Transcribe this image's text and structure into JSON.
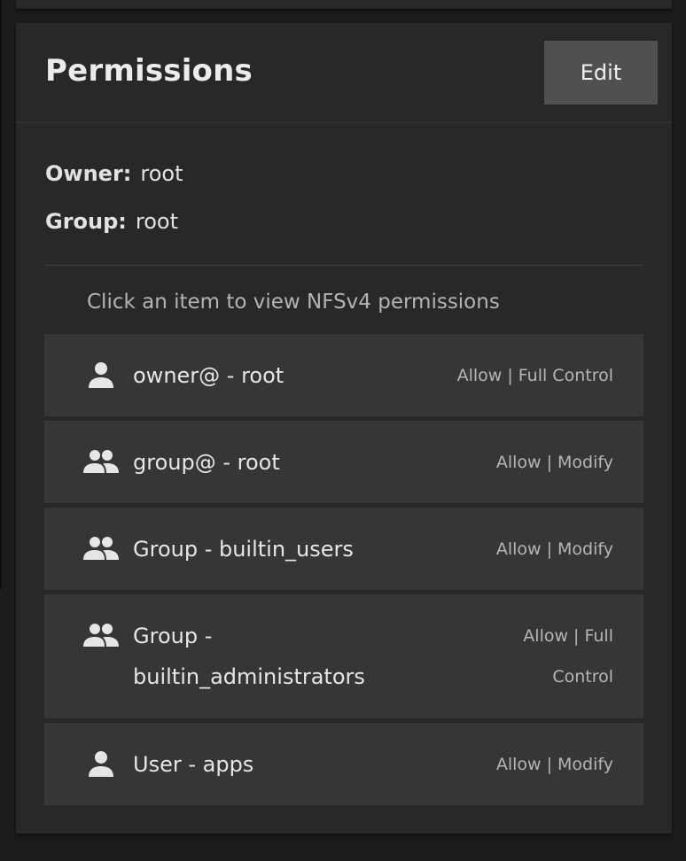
{
  "card": {
    "title": "Permissions",
    "edit_label": "Edit"
  },
  "owner": {
    "label": "Owner:",
    "value": "root"
  },
  "group": {
    "label": "Group:",
    "value": "root"
  },
  "hint": "Click an item to view NFSv4 permissions",
  "aces": [
    {
      "icon": "person-icon",
      "name": "owner@ - root",
      "permission": "Allow | Full Control"
    },
    {
      "icon": "people-icon",
      "name": "group@ - root",
      "permission": "Allow | Modify"
    },
    {
      "icon": "people-icon",
      "name": "Group - builtin_users",
      "permission": "Allow | Modify"
    },
    {
      "icon": "people-icon",
      "name_line1": "Group -",
      "name_line2": "builtin_administrators",
      "permission_line1": "Allow | Full",
      "permission_line2": "Control"
    },
    {
      "icon": "person-icon",
      "name": "User - apps",
      "permission": "Allow | Modify"
    }
  ]
}
